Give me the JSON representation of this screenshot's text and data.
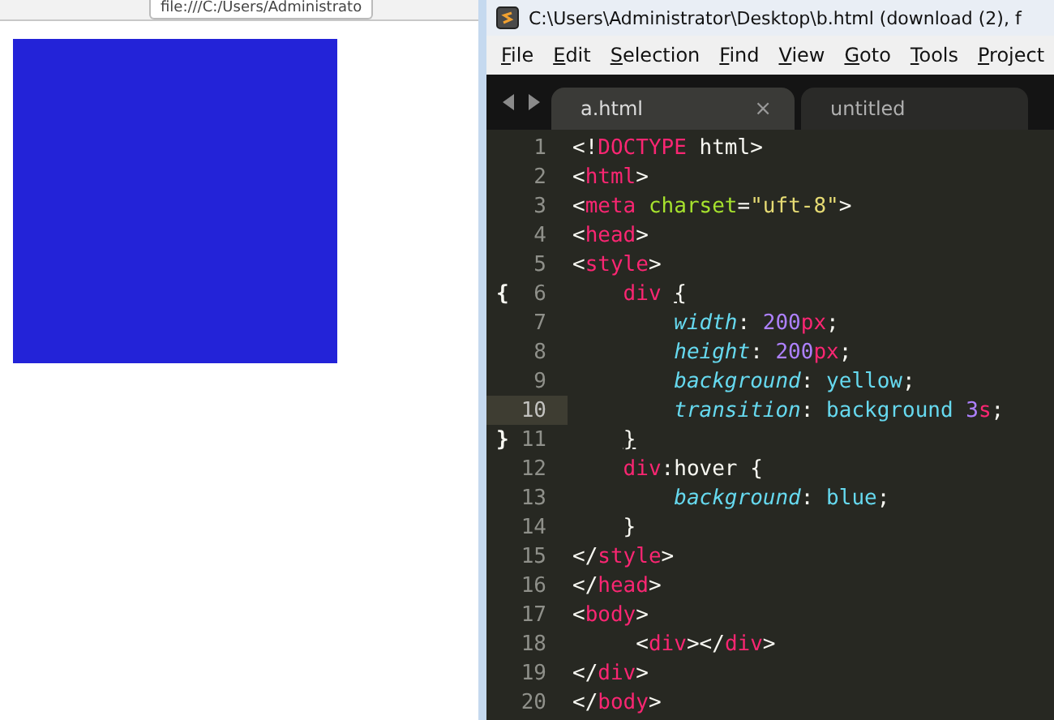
{
  "browser": {
    "address": "file:///C:/Users/Administrato",
    "preview": {
      "color": "#2323d8"
    }
  },
  "editor": {
    "title": "C:\\Users\\Administrator\\Desktop\\b.html (download (2), f",
    "menu": [
      "File",
      "Edit",
      "Selection",
      "Find",
      "View",
      "Goto",
      "Tools",
      "Project"
    ],
    "tabs": [
      {
        "label": "a.html",
        "selected": true,
        "close": "×"
      },
      {
        "label": "untitled",
        "selected": false
      }
    ],
    "lines": [
      {
        "number": "1",
        "highlighted": false,
        "tokens": [
          {
            "kind": "plain",
            "text": "<!"
          },
          {
            "kind": "tag",
            "text": "DOCTYPE"
          },
          {
            "kind": "plain",
            "text": " html>"
          }
        ]
      },
      {
        "number": "2",
        "highlighted": false,
        "tokens": [
          {
            "kind": "plain",
            "text": "<"
          },
          {
            "kind": "tag",
            "text": "html"
          },
          {
            "kind": "plain",
            "text": ">"
          }
        ]
      },
      {
        "number": "3",
        "highlighted": false,
        "tokens": [
          {
            "kind": "plain",
            "text": "<"
          },
          {
            "kind": "tag",
            "text": "meta "
          },
          {
            "kind": "attr",
            "text": "charset"
          },
          {
            "kind": "plain",
            "text": "="
          },
          {
            "kind": "string",
            "text": "\"uft-8\""
          },
          {
            "kind": "plain",
            "text": ">"
          }
        ]
      },
      {
        "number": "4",
        "highlighted": false,
        "tokens": [
          {
            "kind": "plain",
            "text": "<"
          },
          {
            "kind": "tag",
            "text": "head"
          },
          {
            "kind": "plain",
            "text": ">"
          }
        ]
      },
      {
        "number": "5",
        "highlighted": false,
        "tokens": [
          {
            "kind": "plain",
            "text": "<"
          },
          {
            "kind": "tag",
            "text": "style"
          },
          {
            "kind": "plain",
            "text": ">"
          }
        ]
      },
      {
        "number": "6",
        "fold": "{",
        "highlighted": false,
        "tokens": [
          {
            "kind": "tag",
            "text": "    div "
          },
          {
            "kind": "match",
            "text": "{"
          }
        ]
      },
      {
        "number": "7",
        "highlighted": false,
        "tokens": [
          {
            "kind": "prop",
            "text": "        width"
          },
          {
            "kind": "plain",
            "text": ": "
          },
          {
            "kind": "number",
            "text": "200"
          },
          {
            "kind": "tag",
            "text": "px"
          },
          {
            "kind": "plain",
            "text": ";"
          }
        ]
      },
      {
        "number": "8",
        "highlighted": false,
        "tokens": [
          {
            "kind": "prop",
            "text": "        height"
          },
          {
            "kind": "plain",
            "text": ": "
          },
          {
            "kind": "number",
            "text": "200"
          },
          {
            "kind": "tag",
            "text": "px"
          },
          {
            "kind": "plain",
            "text": ";"
          }
        ]
      },
      {
        "number": "9",
        "highlighted": false,
        "tokens": [
          {
            "kind": "prop",
            "text": "        background"
          },
          {
            "kind": "plain",
            "text": ": "
          },
          {
            "kind": "value",
            "text": "yellow"
          },
          {
            "kind": "plain",
            "text": ";"
          }
        ]
      },
      {
        "number": "10",
        "highlighted": true,
        "tokens": [
          {
            "kind": "prop",
            "text": "        transition"
          },
          {
            "kind": "plain",
            "text": ": "
          },
          {
            "kind": "value",
            "text": "background "
          },
          {
            "kind": "number",
            "text": "3"
          },
          {
            "kind": "tag",
            "text": "s"
          },
          {
            "kind": "plain",
            "text": ";"
          }
        ]
      },
      {
        "number": "11",
        "fold": "}",
        "highlighted": false,
        "tokens": [
          {
            "kind": "match",
            "text": "    }"
          }
        ]
      },
      {
        "number": "12",
        "highlighted": false,
        "tokens": [
          {
            "kind": "tag",
            "text": "    div"
          },
          {
            "kind": "plain",
            "text": ":hover {"
          }
        ]
      },
      {
        "number": "13",
        "highlighted": false,
        "tokens": [
          {
            "kind": "prop",
            "text": "        background"
          },
          {
            "kind": "plain",
            "text": ": "
          },
          {
            "kind": "value",
            "text": "blue"
          },
          {
            "kind": "plain",
            "text": ";"
          }
        ]
      },
      {
        "number": "14",
        "highlighted": false,
        "tokens": [
          {
            "kind": "plain",
            "text": "    }"
          }
        ]
      },
      {
        "number": "15",
        "highlighted": false,
        "tokens": [
          {
            "kind": "plain",
            "text": "</"
          },
          {
            "kind": "tag",
            "text": "style"
          },
          {
            "kind": "plain",
            "text": ">"
          }
        ]
      },
      {
        "number": "16",
        "highlighted": false,
        "tokens": [
          {
            "kind": "plain",
            "text": "</"
          },
          {
            "kind": "tag",
            "text": "head"
          },
          {
            "kind": "plain",
            "text": ">"
          }
        ]
      },
      {
        "number": "17",
        "highlighted": false,
        "tokens": [
          {
            "kind": "plain",
            "text": "<"
          },
          {
            "kind": "tag",
            "text": "body"
          },
          {
            "kind": "plain",
            "text": ">"
          }
        ]
      },
      {
        "number": "18",
        "highlighted": false,
        "tokens": [
          {
            "kind": "plain",
            "text": "     <"
          },
          {
            "kind": "tag",
            "text": "div"
          },
          {
            "kind": "plain",
            "text": "></"
          },
          {
            "kind": "tag",
            "text": "div"
          },
          {
            "kind": "plain",
            "text": ">"
          }
        ]
      },
      {
        "number": "19",
        "highlighted": false,
        "tokens": [
          {
            "kind": "plain",
            "text": "</"
          },
          {
            "kind": "tag",
            "text": "div"
          },
          {
            "kind": "plain",
            "text": ">"
          }
        ]
      },
      {
        "number": "20",
        "highlighted": false,
        "tokens": [
          {
            "kind": "plain",
            "text": "</"
          },
          {
            "kind": "tag",
            "text": "body"
          },
          {
            "kind": "plain",
            "text": ">"
          }
        ]
      }
    ]
  }
}
